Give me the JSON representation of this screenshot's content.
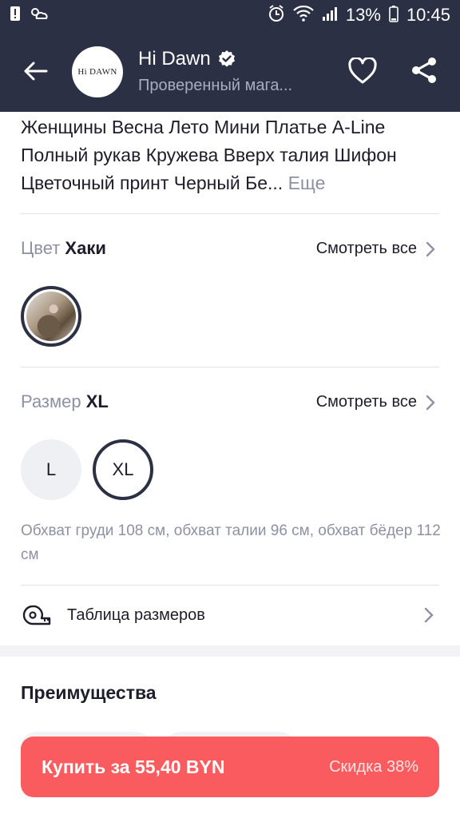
{
  "status": {
    "battery": "13%",
    "time": "10:45"
  },
  "header": {
    "logo_text": "Hi DAWN",
    "shop_name": "Hi Dawn",
    "shop_subtitle": "Проверенный мага..."
  },
  "product": {
    "title": "Женщины Весна Лето Мини Платье A-Line Полный рукав Кружева Вверх талия Шифон Цветочный принт Черный Бе...",
    "more_label": "Еще"
  },
  "color": {
    "label": "Цвет",
    "value": "Хаки",
    "see_all": "Смотреть все"
  },
  "size": {
    "label": "Размер",
    "value": "XL",
    "see_all": "Смотреть все",
    "options": [
      "L",
      "XL"
    ],
    "measurements": "Обхват груди 108 см, обхват талии 96 см, обхват бёдер 112 см"
  },
  "size_table": {
    "label": "Таблица размеров"
  },
  "benefits": {
    "title": "Преимущества"
  },
  "buy": {
    "label": "Купить за 55,40 BYN",
    "discount": "Скидка 38%"
  },
  "colors": {
    "header_bg": "#2c3045",
    "accent": "#fa5b5e",
    "muted": "#8d91a3"
  }
}
